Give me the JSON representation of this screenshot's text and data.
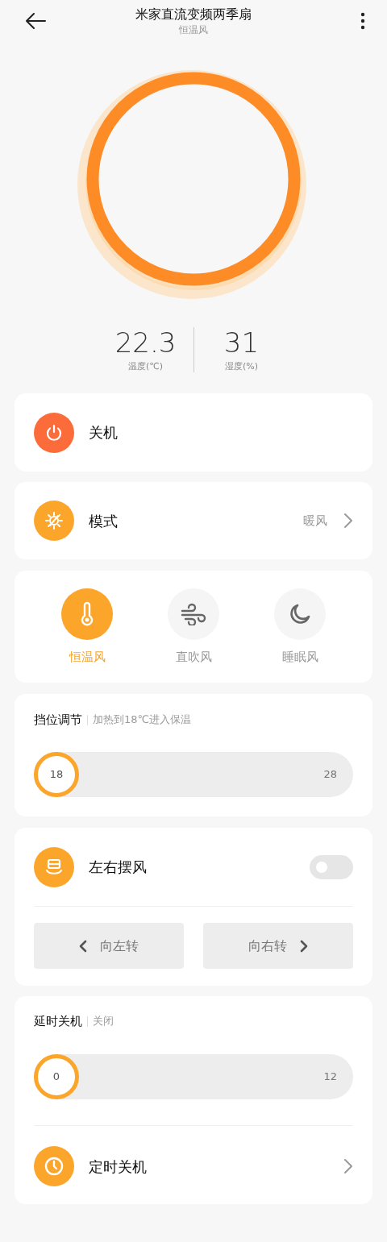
{
  "header": {
    "title": "米家直流变频两季扇",
    "subtitle": "恒温风"
  },
  "readings": [
    {
      "value": "22.3",
      "label": "温度(℃)"
    },
    {
      "value": "31",
      "label": "湿度(%)"
    }
  ],
  "power": {
    "label": "关机"
  },
  "mode": {
    "label": "模式",
    "value": "暖风"
  },
  "wind_modes": [
    {
      "label": "恒温风",
      "kind": "thermometer",
      "selected": true
    },
    {
      "label": "直吹风",
      "kind": "wind",
      "selected": false
    },
    {
      "label": "睡眠风",
      "kind": "moon",
      "selected": false
    }
  ],
  "gear": {
    "title": "挡位调节",
    "hint": "加热到18℃进入保温",
    "level": 0,
    "current": "18",
    "max": "28"
  },
  "swing": {
    "label": "左右摆风",
    "on": false,
    "buttons": [
      {
        "label": "向左转",
        "kind": "left"
      },
      {
        "label": "向右转",
        "kind": "right"
      }
    ]
  },
  "delay": {
    "title": "延时关机",
    "status": "关闭",
    "level": 0,
    "current": "0",
    "max": "12"
  },
  "timer": {
    "label": "定时关机"
  }
}
